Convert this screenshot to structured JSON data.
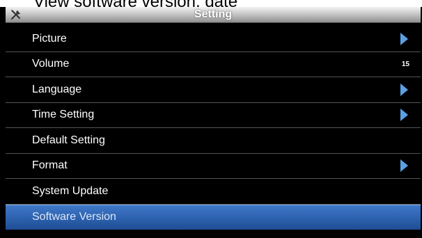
{
  "caption": "View software version, date",
  "header": {
    "title": "Setting",
    "icon": "tools-icon"
  },
  "menu": {
    "items": [
      {
        "label": "Picture",
        "indicator": "arrow"
      },
      {
        "label": "Volume",
        "value": "15"
      },
      {
        "label": "Language",
        "indicator": "arrow"
      },
      {
        "label": "Time Setting",
        "indicator": "arrow"
      },
      {
        "label": "Default Setting"
      },
      {
        "label": "Format",
        "indicator": "arrow"
      },
      {
        "label": "System Update"
      },
      {
        "label": "Software Version",
        "selected": true
      }
    ]
  },
  "colors": {
    "background": "#000000",
    "selected": "#2e63b0",
    "arrow": "#5aa0e6"
  }
}
